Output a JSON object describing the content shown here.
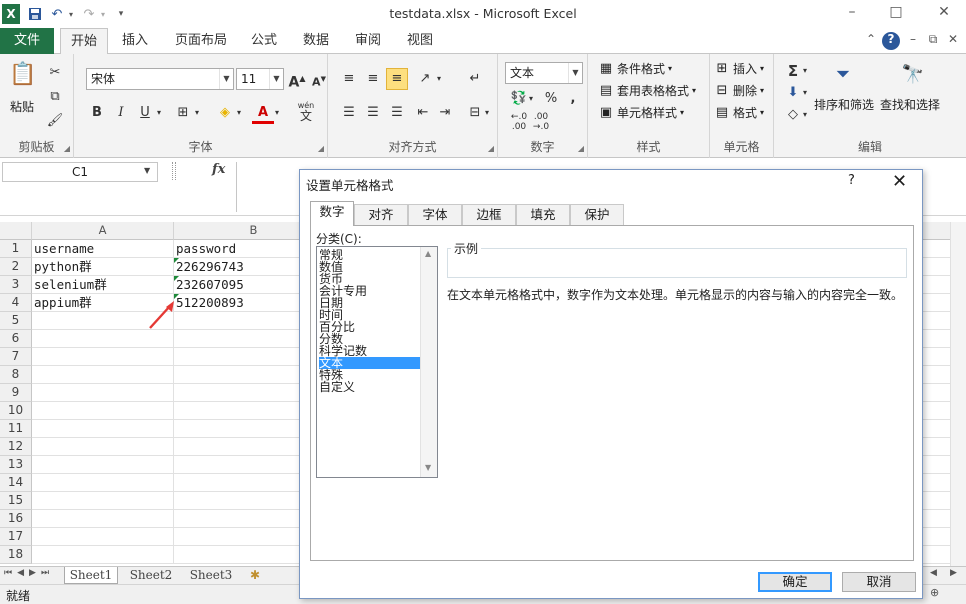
{
  "window": {
    "title": "testdata.xlsx - Microsoft Excel",
    "controls": [
      "?",
      "–",
      "□",
      "✕"
    ]
  },
  "quick_access": {
    "app_icon": "X",
    "items": [
      "save-icon",
      "undo-icon",
      "redo-icon",
      "customize-icon"
    ]
  },
  "tabs": {
    "file": "文件",
    "items": [
      "开始",
      "插入",
      "页面布局",
      "公式",
      "数据",
      "审阅",
      "视图"
    ],
    "active": "开始"
  },
  "ribbon": {
    "clipboard": {
      "label": "剪贴板",
      "paste": "粘贴"
    },
    "font": {
      "label": "字体",
      "font_name": "宋体",
      "font_size": "11",
      "grow": "A",
      "shrink": "A",
      "bold": "B",
      "italic": "I",
      "underline": "U",
      "wen": "wén",
      "wen2": "文"
    },
    "alignment": {
      "label": "对齐方式"
    },
    "number": {
      "label": "数字",
      "format": "文本",
      "percent": "%",
      "comma": ",",
      "inc_dec": ".0\n.00",
      "dec_dec": ".00\n.0"
    },
    "styles": {
      "label": "样式",
      "cond_format": "条件格式",
      "table_format": "套用表格格式",
      "cell_styles": "单元格样式"
    },
    "cells": {
      "label": "单元格",
      "insert": "插入",
      "delete": "删除",
      "format": "格式"
    },
    "editing": {
      "label": "编辑",
      "sum": "Σ",
      "sort_filter": "排序和筛选",
      "find_select": "查找和选择"
    }
  },
  "formula_bar": {
    "name_box": "C1",
    "fx": "fx",
    "value": ""
  },
  "grid": {
    "columns": [
      "A",
      "B"
    ],
    "rows": [
      "1",
      "2",
      "3",
      "4",
      "5",
      "6",
      "7",
      "8",
      "9",
      "10",
      "11",
      "12",
      "13",
      "14",
      "15",
      "16",
      "17",
      "18"
    ],
    "cells": [
      [
        "username",
        "password"
      ],
      [
        "python群",
        "226296743"
      ],
      [
        "selenium群",
        "232607095"
      ],
      [
        "appium群",
        "512200893"
      ]
    ]
  },
  "sheets": {
    "items": [
      "Sheet1",
      "Sheet2",
      "Sheet3"
    ],
    "active": "Sheet1"
  },
  "status": {
    "text": "就绪"
  },
  "dialog": {
    "title": "设置单元格格式",
    "help": "?",
    "close": "✕",
    "tabs": [
      "数字",
      "对齐",
      "字体",
      "边框",
      "填充",
      "保护"
    ],
    "active_tab": "数字",
    "category_label": "分类(C):",
    "categories": [
      "常规",
      "数值",
      "货币",
      "会计专用",
      "日期",
      "时间",
      "百分比",
      "分数",
      "科学记数",
      "文本",
      "特殊",
      "自定义"
    ],
    "selected_category": "文本",
    "sample_label": "示例",
    "description": "在文本单元格格式中，数字作为文本处理。单元格显示的内容与输入的内容完全一致。",
    "ok": "确定",
    "cancel": "取消"
  },
  "colors": {
    "excel_green": "#217346",
    "selection_blue": "#3399ff",
    "arrow_red": "#e53935",
    "text_indicator_green": "#1e8a3a"
  }
}
